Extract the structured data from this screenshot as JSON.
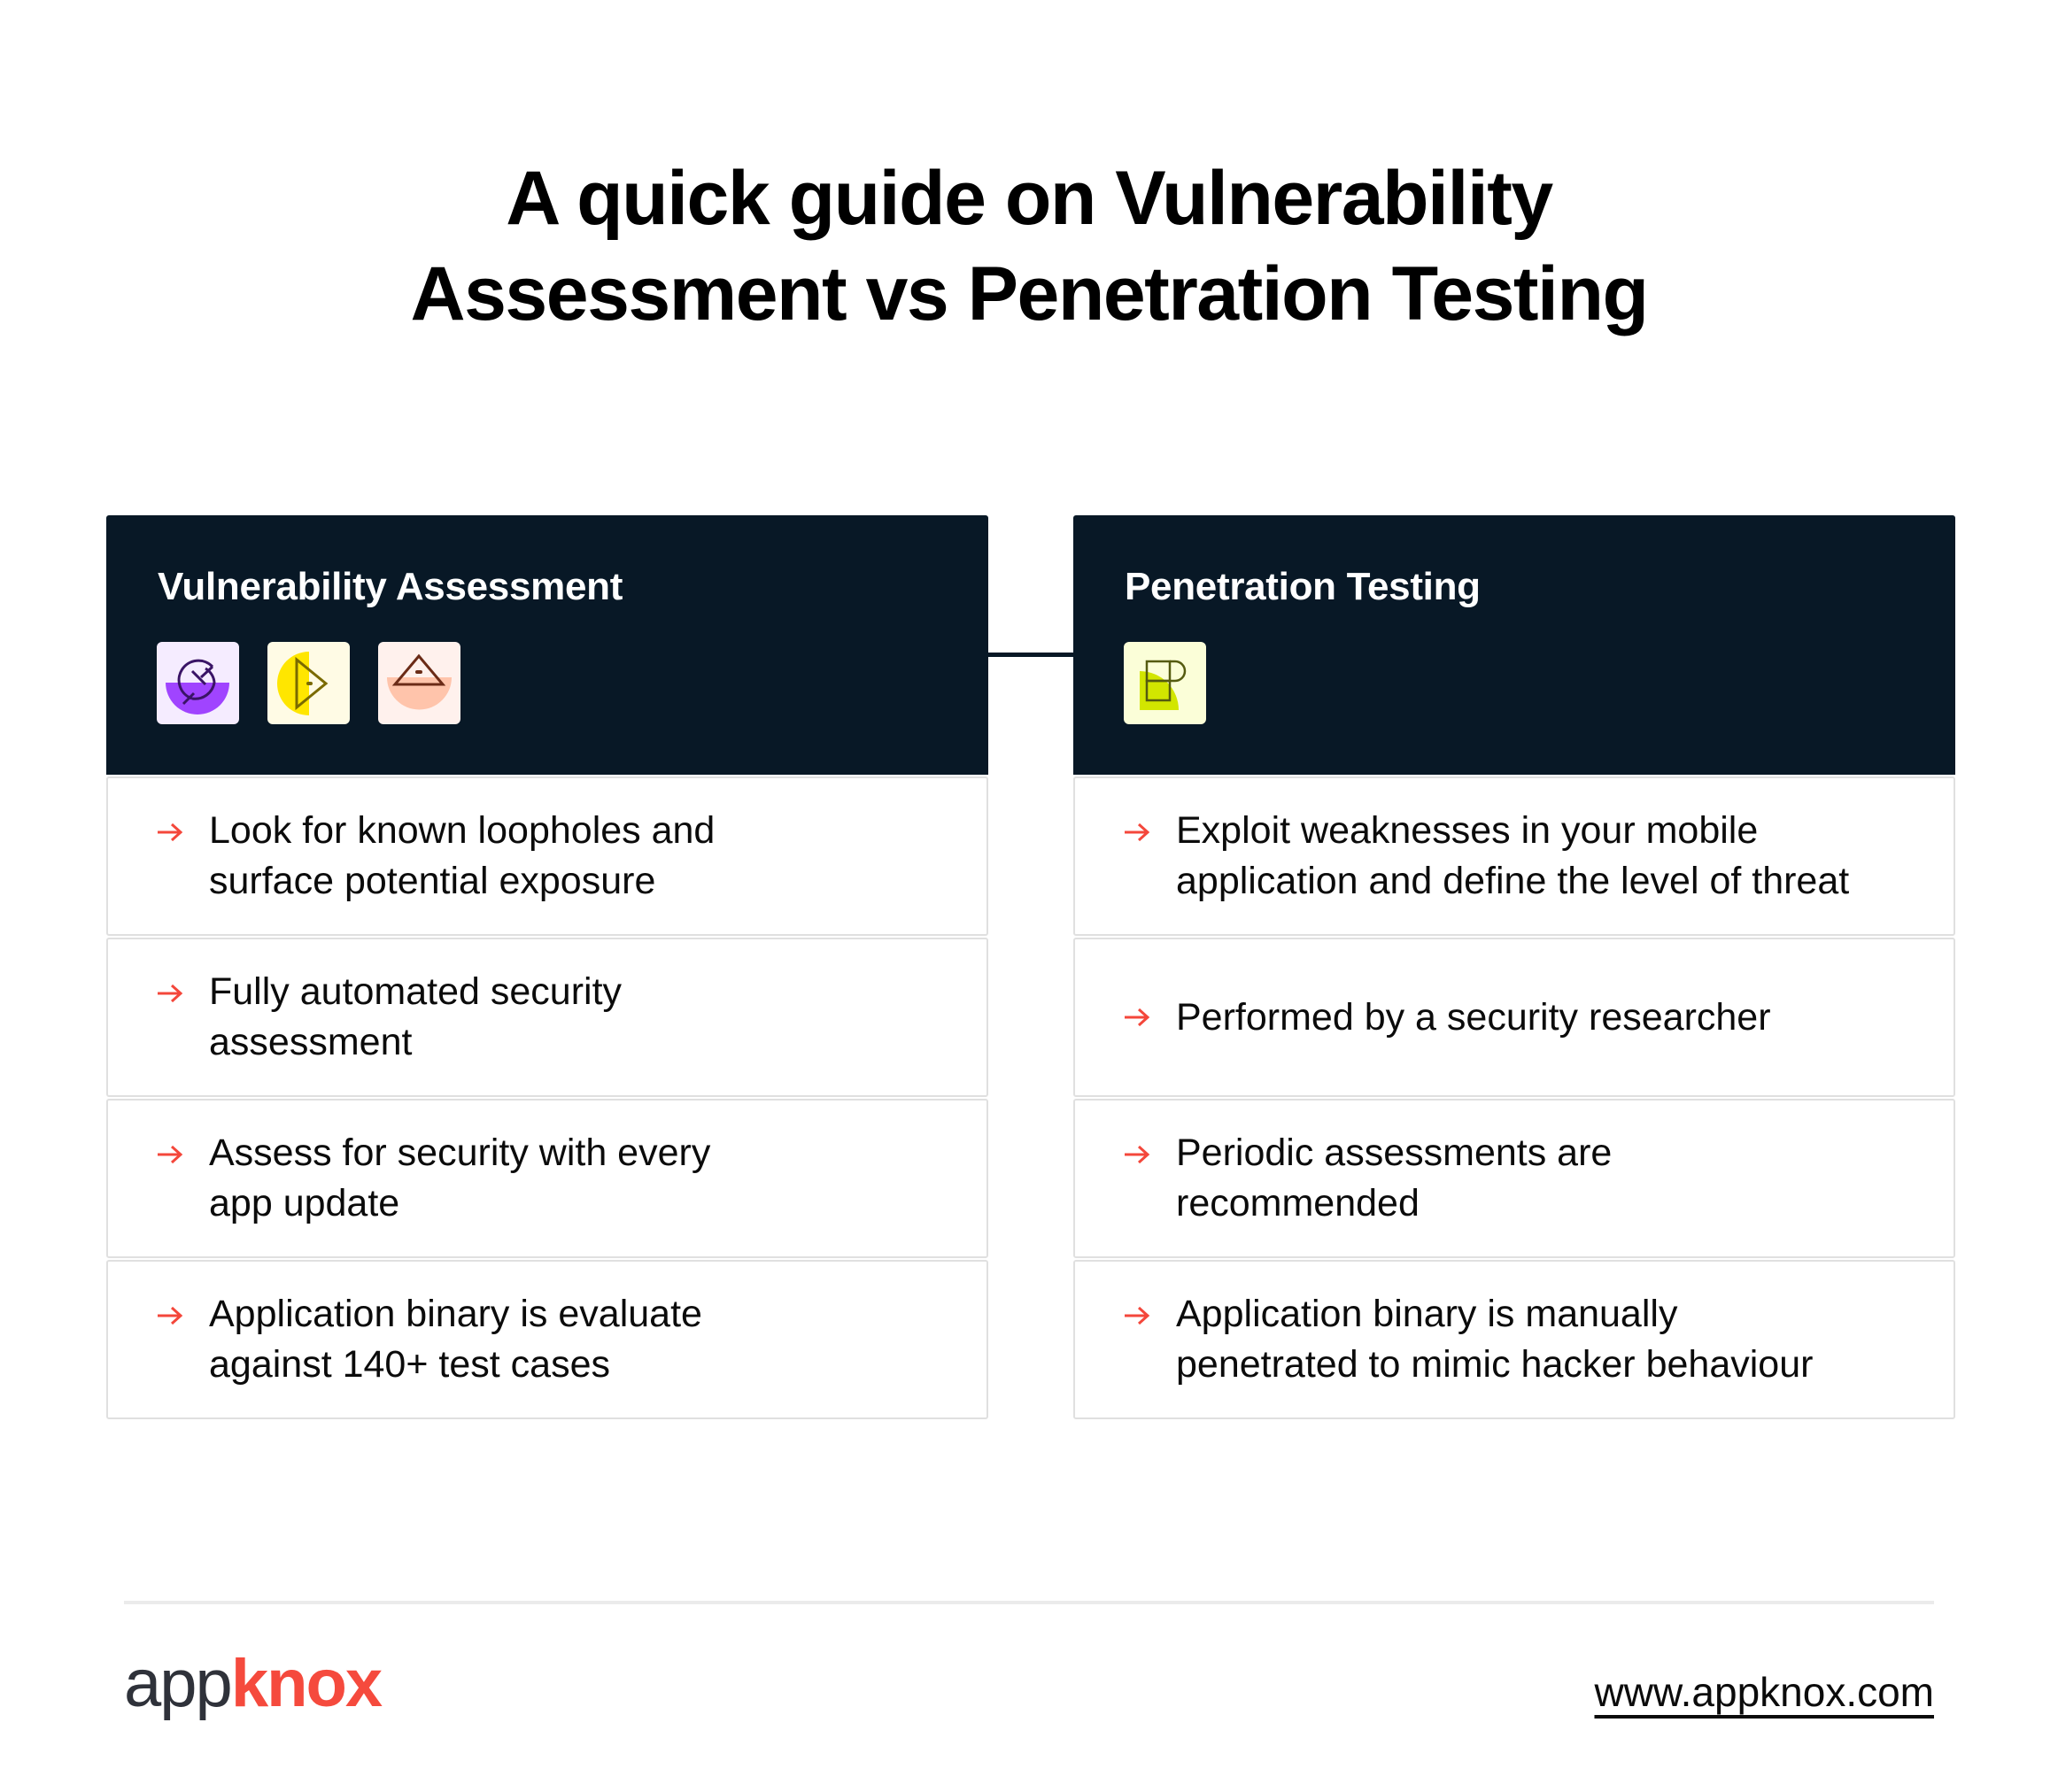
{
  "title": {
    "line1": "A quick guide on Vulnerability",
    "line2": "Assessment vs Penetration Testing"
  },
  "colors": {
    "header_bg": "#081826",
    "accent_arrow": "#f4473b",
    "brand_red": "#f54a3d",
    "brand_dark": "#2f323a"
  },
  "cards": [
    {
      "title": "Vulnerability Assessment",
      "icons": [
        "purple-s-circle-icon",
        "yellow-play-triangle-icon",
        "peach-pyramid-eye-icon"
      ],
      "items": [
        {
          "line1": "Look for known loopholes and",
          "line2": "surface potential exposure"
        },
        {
          "line1": "Fully automated security",
          "line2": "assessment"
        },
        {
          "line1": "Assess for security with every",
          "line2": "app update"
        },
        {
          "line1": "Application binary is evaluate",
          "line2": "against 140+ test cases"
        }
      ]
    },
    {
      "title": "Penetration Testing",
      "icons": [
        "lime-p-blocks-icon"
      ],
      "items": [
        {
          "line1": "Exploit weaknesses in your mobile",
          "line2": "application and define the level of threat"
        },
        {
          "line1": "Performed by a security researcher",
          "line2": ""
        },
        {
          "line1": "Periodic assessments are",
          "line2": "recommended"
        },
        {
          "line1": "Application binary is manually",
          "line2": "penetrated to mimic hacker behaviour"
        }
      ]
    }
  ],
  "footer": {
    "logo_part1": "app",
    "logo_part2": "knox",
    "url": "www.appknox.com"
  }
}
